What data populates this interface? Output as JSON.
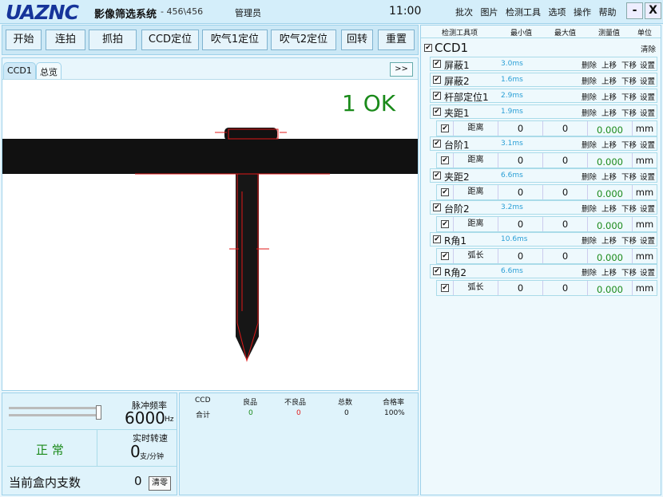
{
  "title": {
    "logo": "UAZNC",
    "app_name": "影像筛选系统",
    "version": "- 456\\456",
    "user": "管理员",
    "clock": "11:00"
  },
  "menu": [
    "批次",
    "图片",
    "检测工具",
    "选项",
    "操作",
    "帮助"
  ],
  "window": {
    "minimize": "-",
    "close": "X"
  },
  "toolbar": [
    "开始",
    "连拍",
    "抓拍",
    "CCD定位",
    "吹气1定位",
    "吹气2定位",
    "回转",
    "重置"
  ],
  "tabs": {
    "ccd1": "CCD1",
    "overview": "总览",
    "more": ">>"
  },
  "result": "1 OK",
  "bottom": {
    "pulse_label": "脉冲频率",
    "pulse_value": "6000",
    "pulse_unit": "Hz",
    "slider_level": 0.97,
    "status": "正 常",
    "speed_label": "实时转速",
    "speed_value": "0",
    "speed_unit": "支/分钟",
    "box_label": "当前盒内支数",
    "box_value": "0",
    "clear": "清零"
  },
  "stats": {
    "headers": [
      "CCD",
      "良品",
      "不良品",
      "总数",
      "合格率"
    ],
    "row": {
      "name": "合计",
      "good": "0",
      "bad": "0",
      "total": "0",
      "rate": "100%"
    },
    "colors": {
      "good": "#1a8a1a",
      "bad": "#e02020"
    }
  },
  "tools": {
    "headers": [
      "检测工具项",
      "最小值",
      "最大值",
      "测量值",
      "单位"
    ],
    "root": "CCD1",
    "clear": "清除",
    "ops": [
      "删除",
      "上移",
      "下移",
      "设置"
    ],
    "items": [
      {
        "name": "屏蔽1",
        "ms": "3.0ms"
      },
      {
        "name": "屏蔽2",
        "ms": "1.6ms"
      },
      {
        "name": "杆部定位1",
        "ms": "2.9ms"
      },
      {
        "name": "夹距1",
        "ms": "1.9ms",
        "sub": {
          "label": "距离",
          "min": "0",
          "max": "0",
          "val": "0.000",
          "unit": "mm"
        }
      },
      {
        "name": "台阶1",
        "ms": "3.1ms",
        "sub": {
          "label": "距离",
          "min": "0",
          "max": "0",
          "val": "0.000",
          "unit": "mm"
        }
      },
      {
        "name": "夹距2",
        "ms": "6.6ms",
        "sub": {
          "label": "距离",
          "min": "0",
          "max": "0",
          "val": "0.000",
          "unit": "mm"
        }
      },
      {
        "name": "台阶2",
        "ms": "3.2ms",
        "sub": {
          "label": "距离",
          "min": "0",
          "max": "0",
          "val": "0.000",
          "unit": "mm"
        }
      },
      {
        "name": "R角1",
        "ms": "10.6ms",
        "sub": {
          "label": "弧长",
          "min": "0",
          "max": "0",
          "val": "0.000",
          "unit": "mm"
        }
      },
      {
        "name": "R角2",
        "ms": "6.6ms",
        "sub": {
          "label": "弧长",
          "min": "0",
          "max": "0",
          "val": "0.000",
          "unit": "mm"
        }
      }
    ]
  },
  "colors": {
    "accent": "#16349a",
    "ok": "#1a8a1a",
    "ms": "#2a9fd6",
    "value": "#1a8a1a"
  }
}
